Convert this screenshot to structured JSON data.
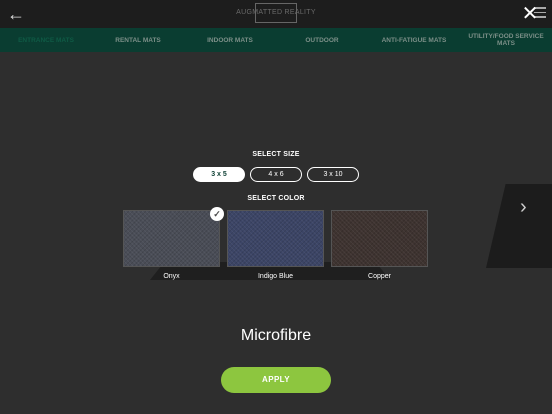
{
  "header": {
    "logo_text": "AUGMATTED REALITY",
    "back_icon": "arrow-left-icon",
    "menu_icon": "hamburger-menu-icon"
  },
  "nav": {
    "items": [
      {
        "label": "ENTRANCE MATS",
        "active": true
      },
      {
        "label": "RENTAL MATS",
        "active": false
      },
      {
        "label": "INDOOR MATS",
        "active": false
      },
      {
        "label": "OUTDOOR",
        "active": false
      },
      {
        "label": "ANTI-FATIGUE MATS",
        "active": false
      },
      {
        "label": "UTILITY/FOOD SERVICE MATS",
        "active": false
      }
    ]
  },
  "modal": {
    "close_icon": "close-icon",
    "select_size_label": "SELECT SIZE",
    "sizes": [
      {
        "label": "3 x 5",
        "selected": true
      },
      {
        "label": "4 x 6",
        "selected": false
      },
      {
        "label": "3 x 10",
        "selected": false
      }
    ],
    "select_color_label": "SELECT COLOR",
    "colors": [
      {
        "name": "Onyx",
        "hex": "#4a4d57",
        "selected": true
      },
      {
        "name": "Indigo Blue",
        "hex": "#3c4566",
        "selected": false
      },
      {
        "name": "Copper",
        "hex": "#3e3330",
        "selected": false
      }
    ],
    "product_title": "Microfibre",
    "apply_label": "APPLY",
    "accent_color": "#8dc63f"
  }
}
